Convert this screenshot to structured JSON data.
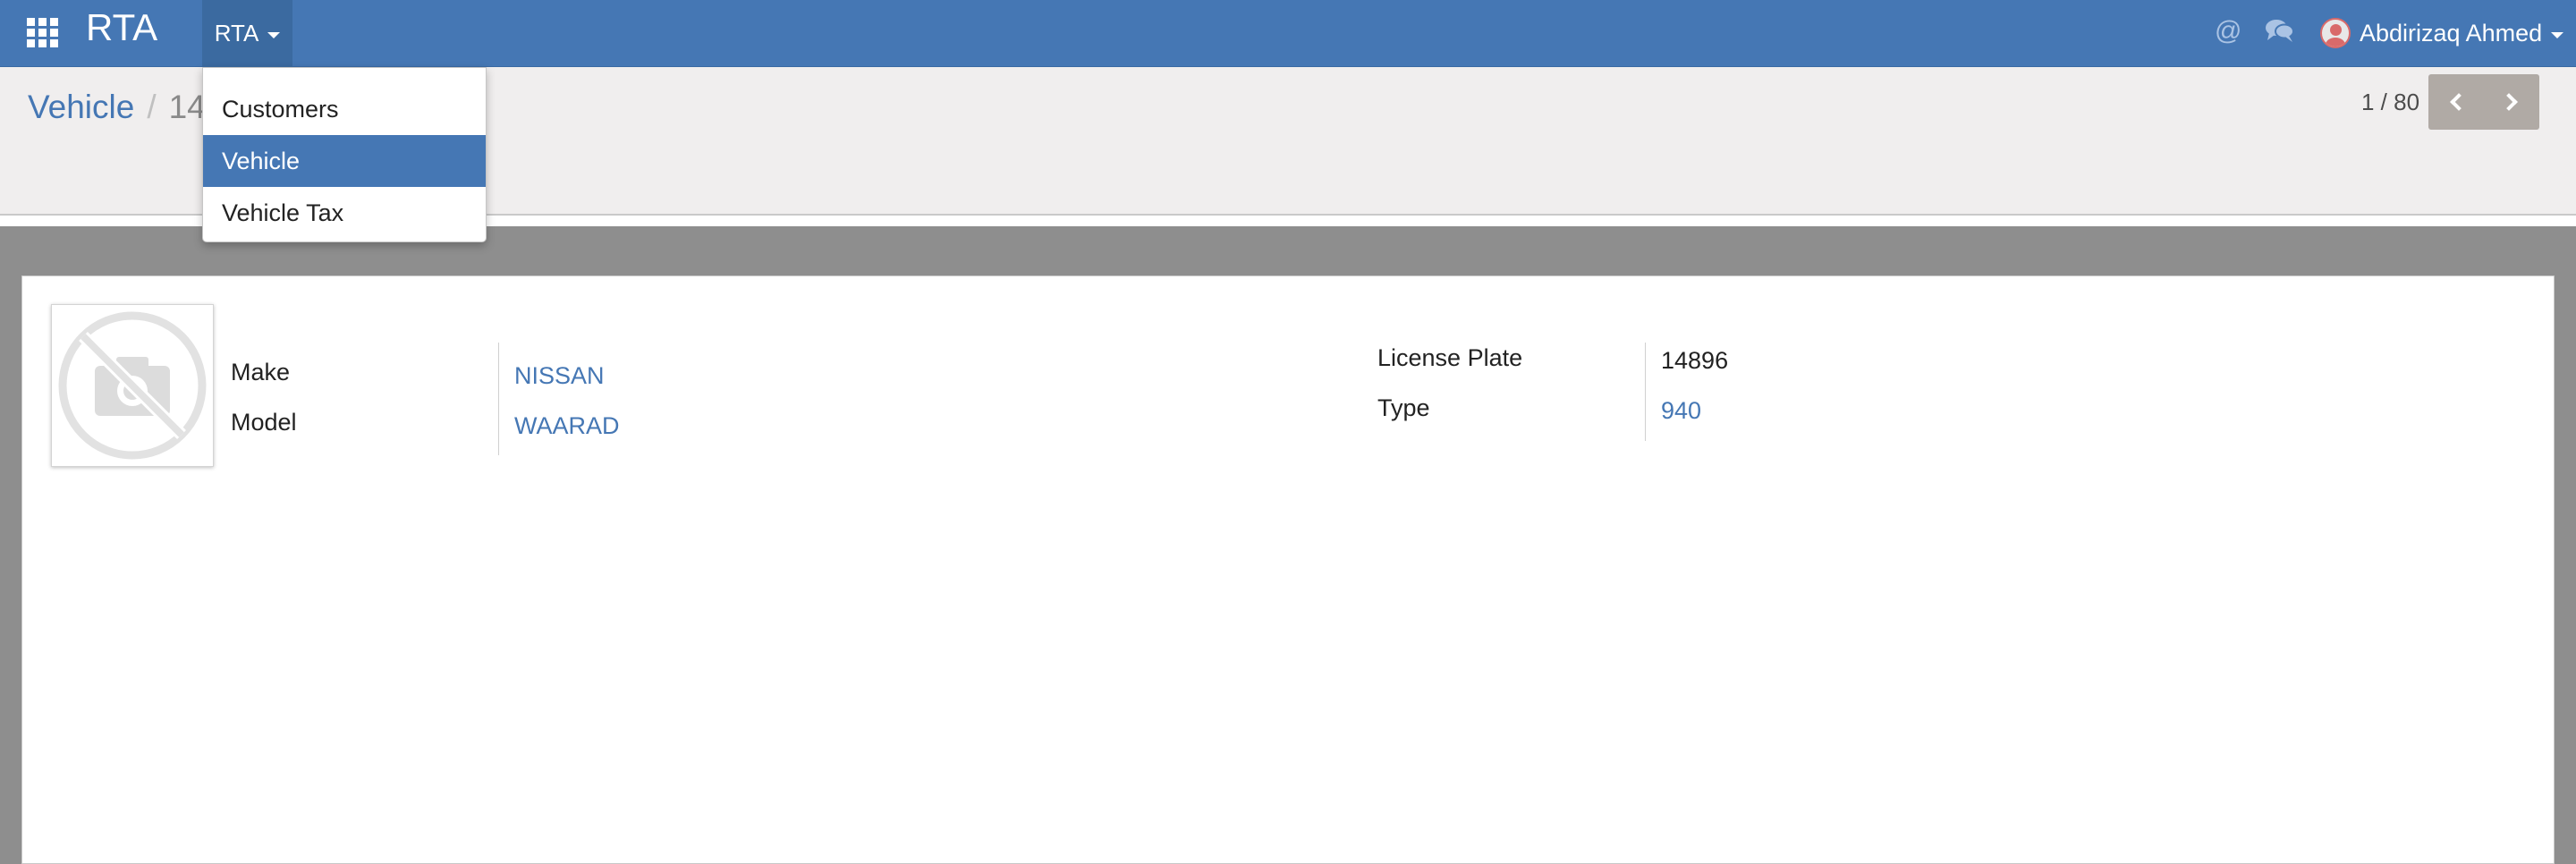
{
  "navbar": {
    "brand": "RTA",
    "menu_label": "RTA",
    "user_name": "Abdirizaq Ahmed"
  },
  "menu": {
    "items": [
      "Customers",
      "Vehicle",
      "Vehicle Tax"
    ],
    "active_index": 1
  },
  "breadcrumb": {
    "parent": "Vehicle",
    "separator": "/",
    "current": "14896"
  },
  "pager": {
    "value": "1 / 80"
  },
  "form": {
    "make_label": "Make",
    "make_value": "NISSAN",
    "model_label": "Model",
    "model_value": "WAARAD",
    "license_plate_label": "License Plate",
    "license_plate_value": "14896",
    "type_label": "Type",
    "type_value": "940"
  },
  "icons": {
    "apps": "apps-grid-icon",
    "mention": "at-icon",
    "chat": "chat-bubbles-icon",
    "pager_prev": "chevron-left-icon",
    "pager_next": "chevron-right-icon",
    "no_photo": "no-camera-icon"
  },
  "colors": {
    "navbar": "#4577b4",
    "link": "#4577b4",
    "active_menu": "#4577b4",
    "pager_buttons": "#b0aaa5"
  }
}
